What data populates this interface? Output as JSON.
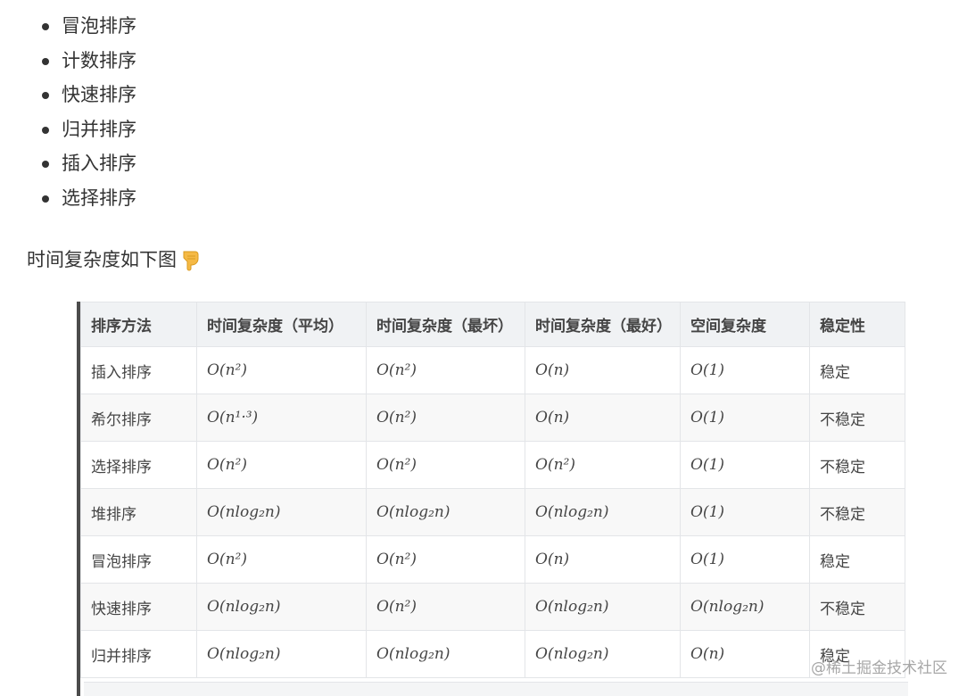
{
  "list": {
    "items": [
      "冒泡排序",
      "计数排序",
      "快速排序",
      "归并排序",
      "插入排序",
      "选择排序"
    ]
  },
  "intro": {
    "text": "时间复杂度如下图",
    "icon": "pointing-down-hand-icon"
  },
  "table": {
    "headers": [
      "排序方法",
      "时间复杂度（平均）",
      "时间复杂度（最坏）",
      "时间复杂度（最好）",
      "空间复杂度",
      "稳定性"
    ],
    "rows": [
      [
        "插入排序",
        "O(n²)",
        "O(n²)",
        "O(n)",
        "O(1)",
        "稳定"
      ],
      [
        "希尔排序",
        "O(n¹·³)",
        "O(n²)",
        "O(n)",
        "O(1)",
        "不稳定"
      ],
      [
        "选择排序",
        "O(n²)",
        "O(n²)",
        "O(n²)",
        "O(1)",
        "不稳定"
      ],
      [
        "堆排序",
        "O(nlog₂n)",
        "O(nlog₂n)",
        "O(nlog₂n)",
        "O(1)",
        "不稳定"
      ],
      [
        "冒泡排序",
        "O(n²)",
        "O(n²)",
        "O(n)",
        "O(1)",
        "稳定"
      ],
      [
        "快速排序",
        "O(nlog₂n)",
        "O(n²)",
        "O(nlog₂n)",
        "O(nlog₂n)",
        "不稳定"
      ],
      [
        "归并排序",
        "O(nlog₂n)",
        "O(nlog₂n)",
        "O(nlog₂n)",
        "O(n)",
        "稳定"
      ]
    ]
  },
  "watermark": "@稀土掘金技术社区",
  "colors": {
    "text": "#333333",
    "header_bg": "#f0f2f4",
    "border": "#e3e5e8",
    "quote_bar": "#4c4c4c"
  }
}
